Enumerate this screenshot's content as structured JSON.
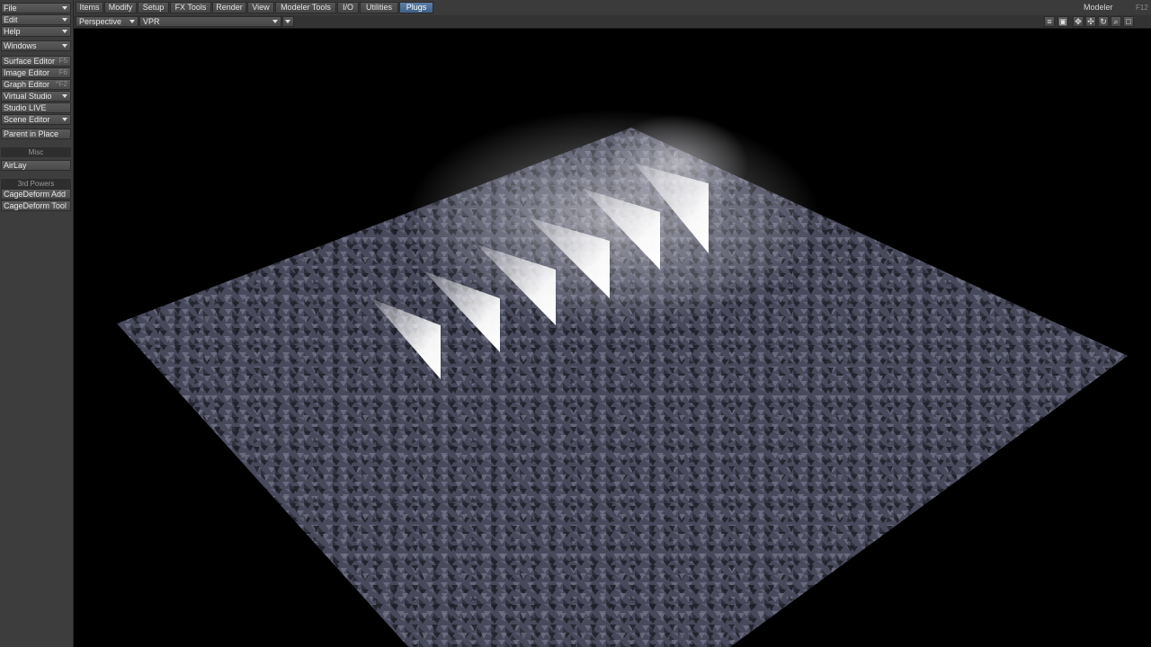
{
  "sidebar": {
    "file_label": "File",
    "edit_label": "Edit",
    "help_label": "Help",
    "windows_label": "Windows",
    "surface_editor": {
      "label": "Surface Editor",
      "key": "F5"
    },
    "image_editor": {
      "label": "Image Editor",
      "key": "F6"
    },
    "graph_editor": {
      "label": "Graph Editor",
      "key": "^F2"
    },
    "virtual_studio_label": "Virtual Studio",
    "studio_live_label": "Studio LIVE",
    "scene_editor_label": "Scene Editor",
    "parent_in_place_label": "Parent in Place",
    "misc_header": "Misc",
    "airlay_label": "AirLay",
    "third_powers_header": "3rd Powers",
    "cagedeform_add_label": "CageDeform Add",
    "cagedeform_tool_label": "CageDeform Tool"
  },
  "tabs": [
    {
      "label": "Items"
    },
    {
      "label": "Modify"
    },
    {
      "label": "Setup"
    },
    {
      "label": "FX Tools"
    },
    {
      "label": "Render"
    },
    {
      "label": "View"
    },
    {
      "label": "Modeler Tools"
    },
    {
      "label": "I/O"
    },
    {
      "label": "Utilities"
    },
    {
      "label": "Plugs",
      "active": true
    }
  ],
  "modeler": {
    "label": "Modeler",
    "key": "F12"
  },
  "viewport": {
    "view_mode": "Perspective",
    "render_mode": "VPR"
  },
  "colors": {
    "active_tab": "#4a6d96",
    "panel": "#3d3d3d",
    "ground": "#55566c"
  },
  "icons": [
    "list-icon",
    "save-icon",
    "move-icon",
    "pan-icon",
    "rotate-icon",
    "zoom-icon",
    "maximize-icon"
  ]
}
